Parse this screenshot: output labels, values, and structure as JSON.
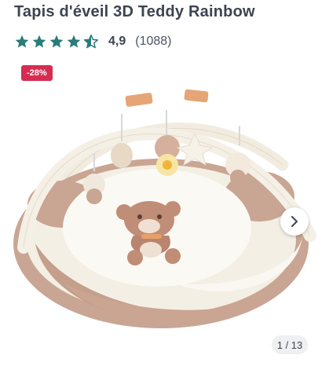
{
  "product": {
    "title": "Tapis d'éveil 3D Teddy Rainbow",
    "rating_value": "4,9",
    "rating_count": "(1088)",
    "stars": 4.5,
    "discount_badge": "-28%"
  },
  "gallery": {
    "pager": "1 / 13",
    "next_icon": "chevron-right-icon"
  },
  "colors": {
    "star": "#2a7c7a",
    "badge": "#d62c52",
    "title": "#3d4451"
  }
}
